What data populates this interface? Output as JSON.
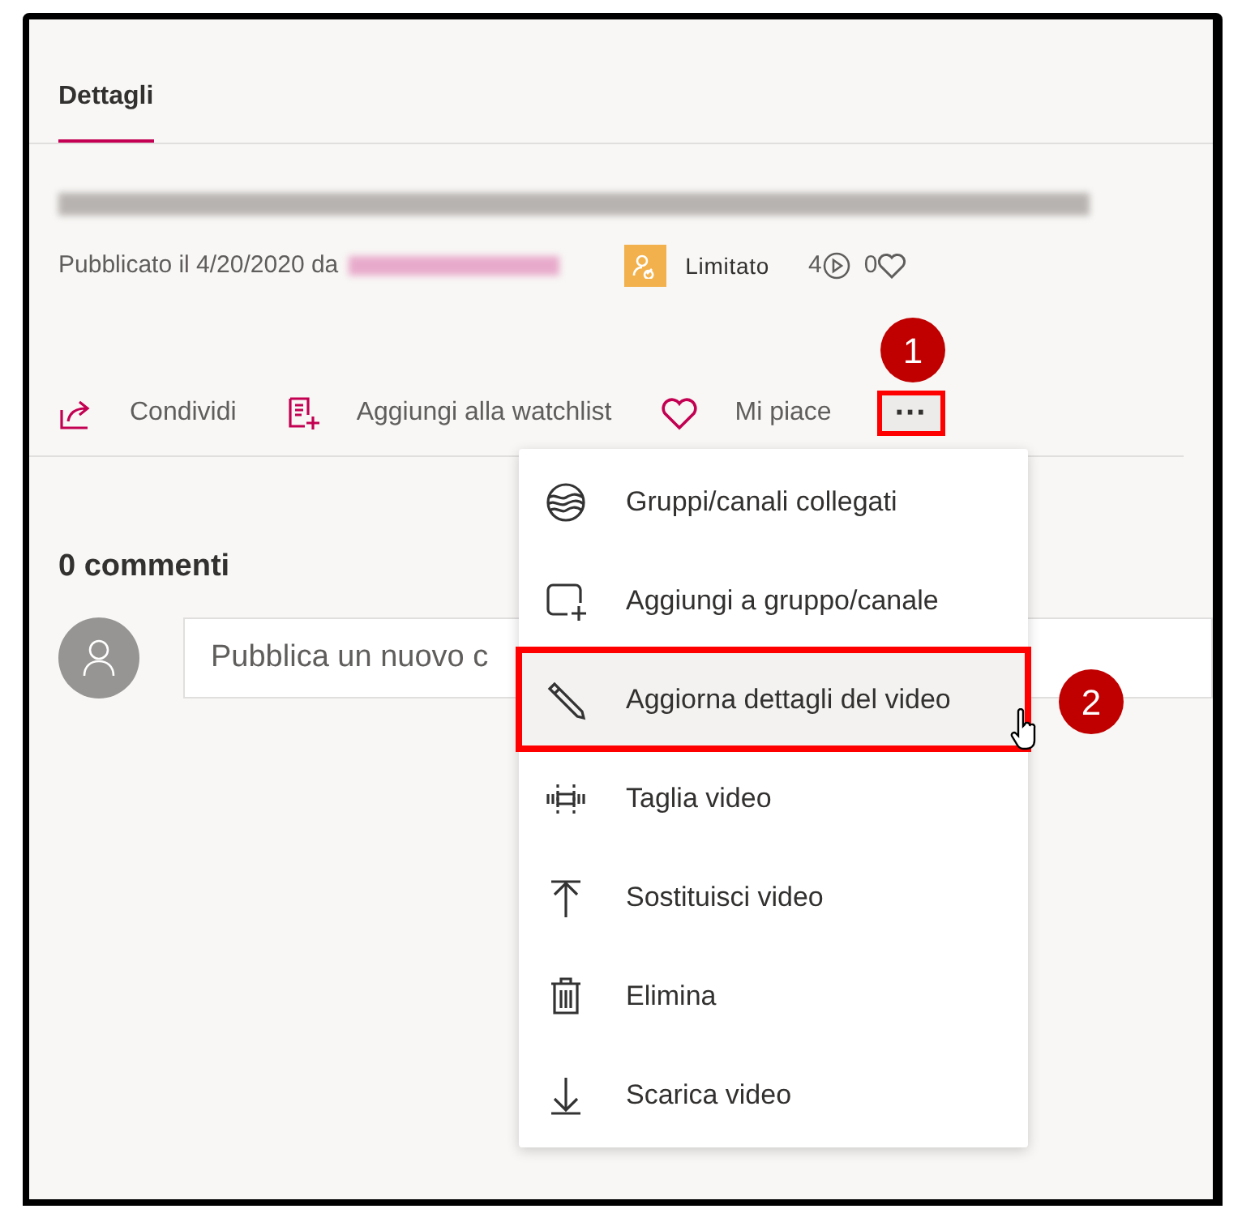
{
  "tabs": [
    {
      "label": "Dettagli",
      "selected": true
    }
  ],
  "video": {
    "published": "Pubblicato il 4/20/2020 da",
    "visibility": "Limitato",
    "views": "4",
    "likes": "0"
  },
  "actions": [
    {
      "label": "Condividi"
    },
    {
      "label": "Aggiungi alla watchlist"
    },
    {
      "label": "Mi piace"
    }
  ],
  "more_button": {
    "label": "···",
    "highlighted": true,
    "callout": "1"
  },
  "comments": {
    "count": "0 commenti",
    "placeholder": "Pubblica un nuovo c"
  },
  "menu": [
    {
      "label": "Gruppi/canali collegati",
      "highlighted": false
    },
    {
      "label": "Aggiungi a gruppo/canale",
      "highlighted": false
    },
    {
      "label": "Aggiorna dettagli del video",
      "highlighted": true,
      "callout": "2"
    },
    {
      "label": "Taglia video",
      "highlighted": false
    },
    {
      "label": "Sostituisci video",
      "highlighted": false
    },
    {
      "label": "Elimina",
      "highlighted": false
    },
    {
      "label": "Scarica video",
      "highlighted": false
    }
  ]
}
